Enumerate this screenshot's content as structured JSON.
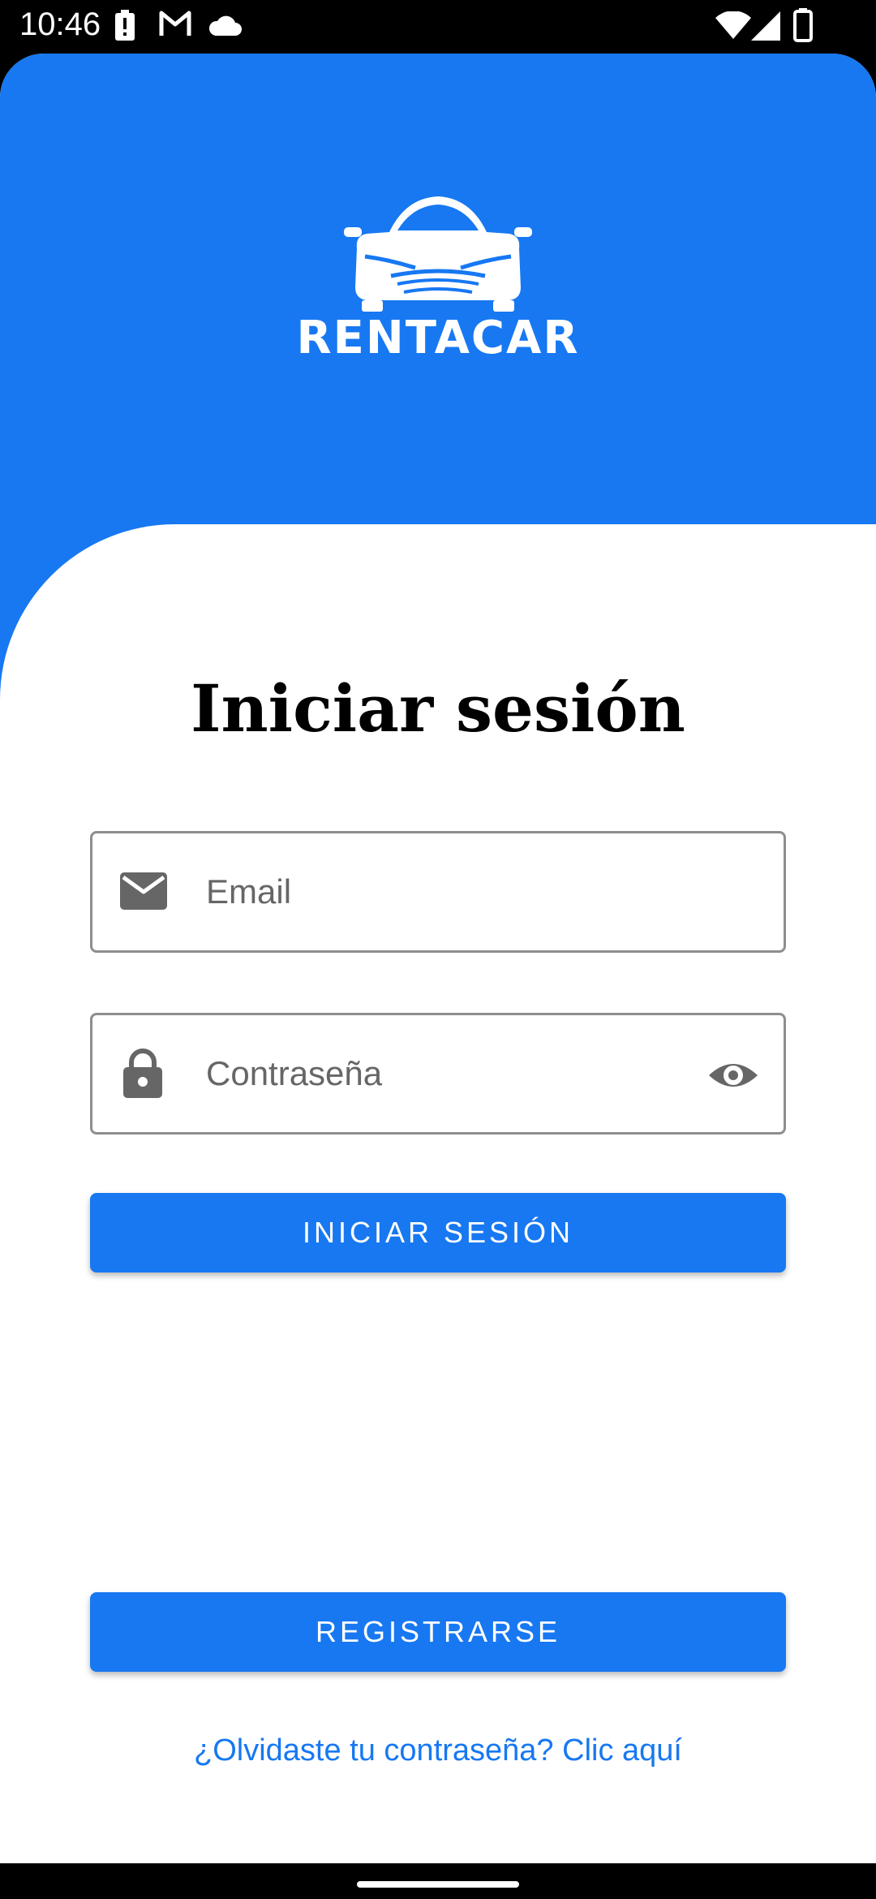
{
  "status_bar": {
    "time": "10:46",
    "left_icons": [
      "alert-battery-icon",
      "gmail-icon",
      "cloud-icon"
    ],
    "right_icons": [
      "wifi-icon",
      "signal-icon",
      "battery-icon"
    ]
  },
  "brand": {
    "logo_text": "RENTACAR",
    "accent_color": "#1778F2"
  },
  "login": {
    "title": "Iniciar sesión",
    "email_placeholder": "Email",
    "password_placeholder": "Contraseña",
    "login_button": "INICIAR SESIÓN",
    "register_button": "REGISTRARSE",
    "forgot_link": "¿Olvidaste tu contraseña? Clic aquí"
  }
}
